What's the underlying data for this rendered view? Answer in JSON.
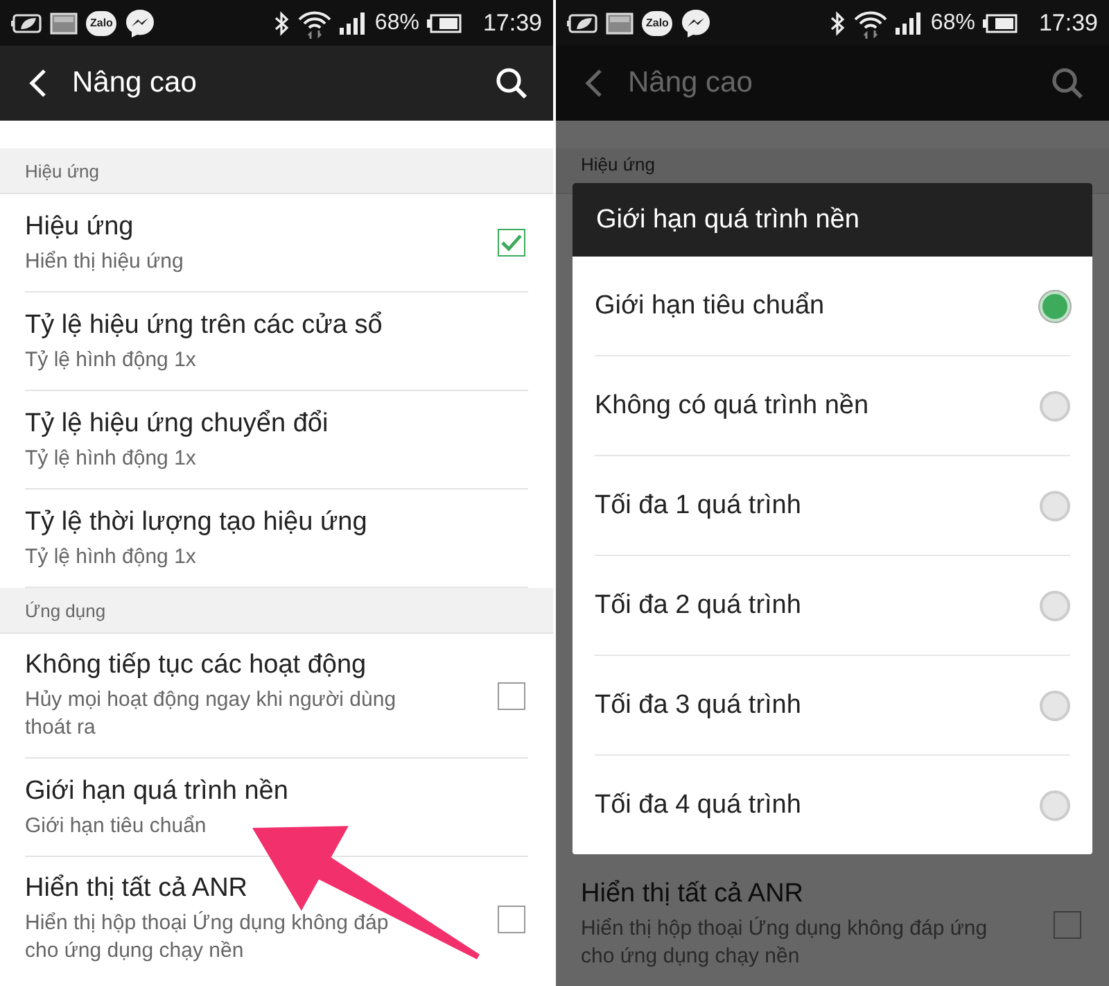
{
  "left_screen": {
    "status_bar": {
      "app_icon_label": "Zalo",
      "battery": "68%",
      "time": "17:39"
    },
    "app_bar": {
      "title": "Nâng cao"
    },
    "list": [
      {
        "kind": "section",
        "title": "Hiệu ứng"
      },
      {
        "kind": "item",
        "title": "Hiệu ứng",
        "subtitle_lines": [
          "Hiển thị hiệu ứng"
        ],
        "checked": true
      },
      {
        "kind": "item",
        "title": "Tỷ lệ hiệu ứng trên các cửa sổ",
        "subtitle_lines": [
          "Tỷ lệ hình động 1x"
        ]
      },
      {
        "kind": "item",
        "title": "Tỷ lệ hiệu ứng chuyển đổi",
        "subtitle_lines": [
          "Tỷ lệ hình động 1x"
        ]
      },
      {
        "kind": "item",
        "title": "Tỷ lệ thời lượng tạo hiệu ứng",
        "subtitle_lines": [
          "Tỷ lệ hình động 1x"
        ]
      },
      {
        "kind": "section",
        "title": "Ứng dụng"
      },
      {
        "kind": "item",
        "title": "Không tiếp tục các hoạt động",
        "subtitle_lines": [
          "Hủy mọi hoạt động ngay khi người dùng",
          "thoát ra"
        ],
        "checked": false
      },
      {
        "kind": "item",
        "title": "Giới hạn quá trình nền",
        "subtitle_lines": [
          "Giới hạn tiêu chuẩn"
        ]
      },
      {
        "kind": "item",
        "title": "Hiển thị tất cả ANR",
        "subtitle_lines": [
          "Hiển thị hộp thoại Ứng dụng không đáp",
          "cho ứng dụng chạy nền"
        ],
        "checked": false
      }
    ]
  },
  "right_screen": {
    "status_bar": {
      "app_icon_label": "Zalo",
      "battery": "68%",
      "time": "17:39"
    },
    "app_bar": {
      "title": "Nâng cao"
    },
    "list": [
      {
        "kind": "section",
        "title": "Hiệu ứng"
      },
      {
        "kind": "spacer"
      },
      {
        "kind": "item",
        "title": "Hiển thị tất cả ANR",
        "subtitle_lines": [
          "Hiển thị hộp thoại Ứng dụng không đáp ứng",
          "cho ứng dụng chạy nền"
        ],
        "checked": false
      }
    ],
    "dialog": {
      "title": "Giới hạn quá trình nền",
      "options": [
        {
          "label": "Giới hạn tiêu chuẩn",
          "selected": true
        },
        {
          "label": "Không có quá trình nền",
          "selected": false
        },
        {
          "label": "Tối đa 1 quá trình",
          "selected": false
        },
        {
          "label": "Tối đa 2 quá trình",
          "selected": false
        },
        {
          "label": "Tối đa 3 quá trình",
          "selected": false
        },
        {
          "label": "Tối đa 4 quá trình",
          "selected": false
        }
      ]
    }
  }
}
